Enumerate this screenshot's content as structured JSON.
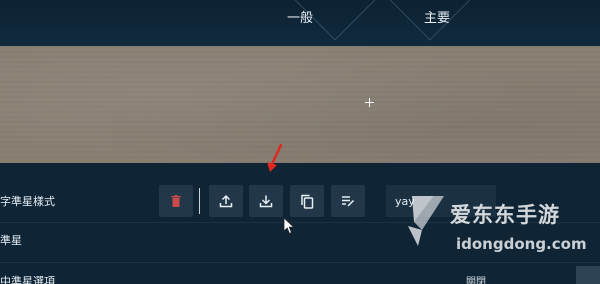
{
  "tabs": [
    {
      "label": "一般"
    },
    {
      "label": "主要"
    }
  ],
  "crosshair_style": {
    "label": "字準星樣式",
    "name_value": "yay"
  },
  "crosshair_section": {
    "label": "準星"
  },
  "options_row": {
    "label": "中準星選項",
    "right_label": "關閉"
  },
  "toolbar": {
    "icons": [
      "trash-icon",
      "upload-icon",
      "download-icon",
      "copy-icon",
      "edit-list-icon"
    ]
  },
  "watermark": {
    "name": "爱东东手游",
    "url": "idongdong.com"
  },
  "colors": {
    "background": "#0f2536",
    "button": "#22384a",
    "delete_icon": "#c94b4b",
    "annotation_arrow": "#e0281e",
    "preview": "#8a8175"
  }
}
